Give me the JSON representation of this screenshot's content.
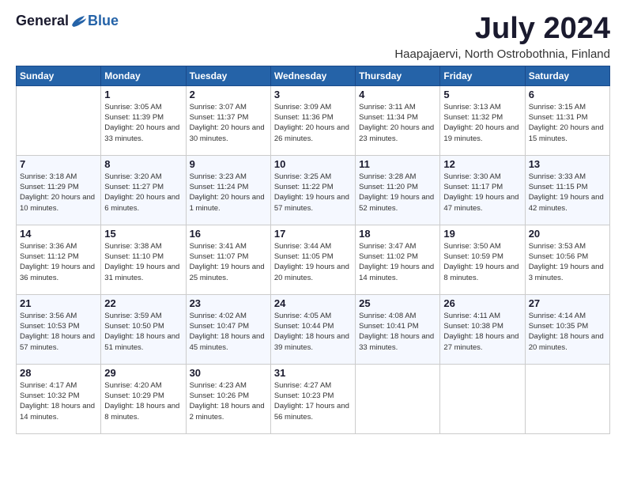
{
  "logo": {
    "general": "General",
    "blue": "Blue"
  },
  "title": {
    "month": "July 2024",
    "location": "Haapajaervi, North Ostrobothnia, Finland"
  },
  "headers": [
    "Sunday",
    "Monday",
    "Tuesday",
    "Wednesday",
    "Thursday",
    "Friday",
    "Saturday"
  ],
  "weeks": [
    [
      {
        "day": "",
        "sunrise": "",
        "sunset": "",
        "daylight": ""
      },
      {
        "day": "1",
        "sunrise": "Sunrise: 3:05 AM",
        "sunset": "Sunset: 11:39 PM",
        "daylight": "Daylight: 20 hours and 33 minutes."
      },
      {
        "day": "2",
        "sunrise": "Sunrise: 3:07 AM",
        "sunset": "Sunset: 11:37 PM",
        "daylight": "Daylight: 20 hours and 30 minutes."
      },
      {
        "day": "3",
        "sunrise": "Sunrise: 3:09 AM",
        "sunset": "Sunset: 11:36 PM",
        "daylight": "Daylight: 20 hours and 26 minutes."
      },
      {
        "day": "4",
        "sunrise": "Sunrise: 3:11 AM",
        "sunset": "Sunset: 11:34 PM",
        "daylight": "Daylight: 20 hours and 23 minutes."
      },
      {
        "day": "5",
        "sunrise": "Sunrise: 3:13 AM",
        "sunset": "Sunset: 11:32 PM",
        "daylight": "Daylight: 20 hours and 19 minutes."
      },
      {
        "day": "6",
        "sunrise": "Sunrise: 3:15 AM",
        "sunset": "Sunset: 11:31 PM",
        "daylight": "Daylight: 20 hours and 15 minutes."
      }
    ],
    [
      {
        "day": "7",
        "sunrise": "Sunrise: 3:18 AM",
        "sunset": "Sunset: 11:29 PM",
        "daylight": "Daylight: 20 hours and 10 minutes."
      },
      {
        "day": "8",
        "sunrise": "Sunrise: 3:20 AM",
        "sunset": "Sunset: 11:27 PM",
        "daylight": "Daylight: 20 hours and 6 minutes."
      },
      {
        "day": "9",
        "sunrise": "Sunrise: 3:23 AM",
        "sunset": "Sunset: 11:24 PM",
        "daylight": "Daylight: 20 hours and 1 minute."
      },
      {
        "day": "10",
        "sunrise": "Sunrise: 3:25 AM",
        "sunset": "Sunset: 11:22 PM",
        "daylight": "Daylight: 19 hours and 57 minutes."
      },
      {
        "day": "11",
        "sunrise": "Sunrise: 3:28 AM",
        "sunset": "Sunset: 11:20 PM",
        "daylight": "Daylight: 19 hours and 52 minutes."
      },
      {
        "day": "12",
        "sunrise": "Sunrise: 3:30 AM",
        "sunset": "Sunset: 11:17 PM",
        "daylight": "Daylight: 19 hours and 47 minutes."
      },
      {
        "day": "13",
        "sunrise": "Sunrise: 3:33 AM",
        "sunset": "Sunset: 11:15 PM",
        "daylight": "Daylight: 19 hours and 42 minutes."
      }
    ],
    [
      {
        "day": "14",
        "sunrise": "Sunrise: 3:36 AM",
        "sunset": "Sunset: 11:12 PM",
        "daylight": "Daylight: 19 hours and 36 minutes."
      },
      {
        "day": "15",
        "sunrise": "Sunrise: 3:38 AM",
        "sunset": "Sunset: 11:10 PM",
        "daylight": "Daylight: 19 hours and 31 minutes."
      },
      {
        "day": "16",
        "sunrise": "Sunrise: 3:41 AM",
        "sunset": "Sunset: 11:07 PM",
        "daylight": "Daylight: 19 hours and 25 minutes."
      },
      {
        "day": "17",
        "sunrise": "Sunrise: 3:44 AM",
        "sunset": "Sunset: 11:05 PM",
        "daylight": "Daylight: 19 hours and 20 minutes."
      },
      {
        "day": "18",
        "sunrise": "Sunrise: 3:47 AM",
        "sunset": "Sunset: 11:02 PM",
        "daylight": "Daylight: 19 hours and 14 minutes."
      },
      {
        "day": "19",
        "sunrise": "Sunrise: 3:50 AM",
        "sunset": "Sunset: 10:59 PM",
        "daylight": "Daylight: 19 hours and 8 minutes."
      },
      {
        "day": "20",
        "sunrise": "Sunrise: 3:53 AM",
        "sunset": "Sunset: 10:56 PM",
        "daylight": "Daylight: 19 hours and 3 minutes."
      }
    ],
    [
      {
        "day": "21",
        "sunrise": "Sunrise: 3:56 AM",
        "sunset": "Sunset: 10:53 PM",
        "daylight": "Daylight: 18 hours and 57 minutes."
      },
      {
        "day": "22",
        "sunrise": "Sunrise: 3:59 AM",
        "sunset": "Sunset: 10:50 PM",
        "daylight": "Daylight: 18 hours and 51 minutes."
      },
      {
        "day": "23",
        "sunrise": "Sunrise: 4:02 AM",
        "sunset": "Sunset: 10:47 PM",
        "daylight": "Daylight: 18 hours and 45 minutes."
      },
      {
        "day": "24",
        "sunrise": "Sunrise: 4:05 AM",
        "sunset": "Sunset: 10:44 PM",
        "daylight": "Daylight: 18 hours and 39 minutes."
      },
      {
        "day": "25",
        "sunrise": "Sunrise: 4:08 AM",
        "sunset": "Sunset: 10:41 PM",
        "daylight": "Daylight: 18 hours and 33 minutes."
      },
      {
        "day": "26",
        "sunrise": "Sunrise: 4:11 AM",
        "sunset": "Sunset: 10:38 PM",
        "daylight": "Daylight: 18 hours and 27 minutes."
      },
      {
        "day": "27",
        "sunrise": "Sunrise: 4:14 AM",
        "sunset": "Sunset: 10:35 PM",
        "daylight": "Daylight: 18 hours and 20 minutes."
      }
    ],
    [
      {
        "day": "28",
        "sunrise": "Sunrise: 4:17 AM",
        "sunset": "Sunset: 10:32 PM",
        "daylight": "Daylight: 18 hours and 14 minutes."
      },
      {
        "day": "29",
        "sunrise": "Sunrise: 4:20 AM",
        "sunset": "Sunset: 10:29 PM",
        "daylight": "Daylight: 18 hours and 8 minutes."
      },
      {
        "day": "30",
        "sunrise": "Sunrise: 4:23 AM",
        "sunset": "Sunset: 10:26 PM",
        "daylight": "Daylight: 18 hours and 2 minutes."
      },
      {
        "day": "31",
        "sunrise": "Sunrise: 4:27 AM",
        "sunset": "Sunset: 10:23 PM",
        "daylight": "Daylight: 17 hours and 56 minutes."
      },
      {
        "day": "",
        "sunrise": "",
        "sunset": "",
        "daylight": ""
      },
      {
        "day": "",
        "sunrise": "",
        "sunset": "",
        "daylight": ""
      },
      {
        "day": "",
        "sunrise": "",
        "sunset": "",
        "daylight": ""
      }
    ]
  ]
}
